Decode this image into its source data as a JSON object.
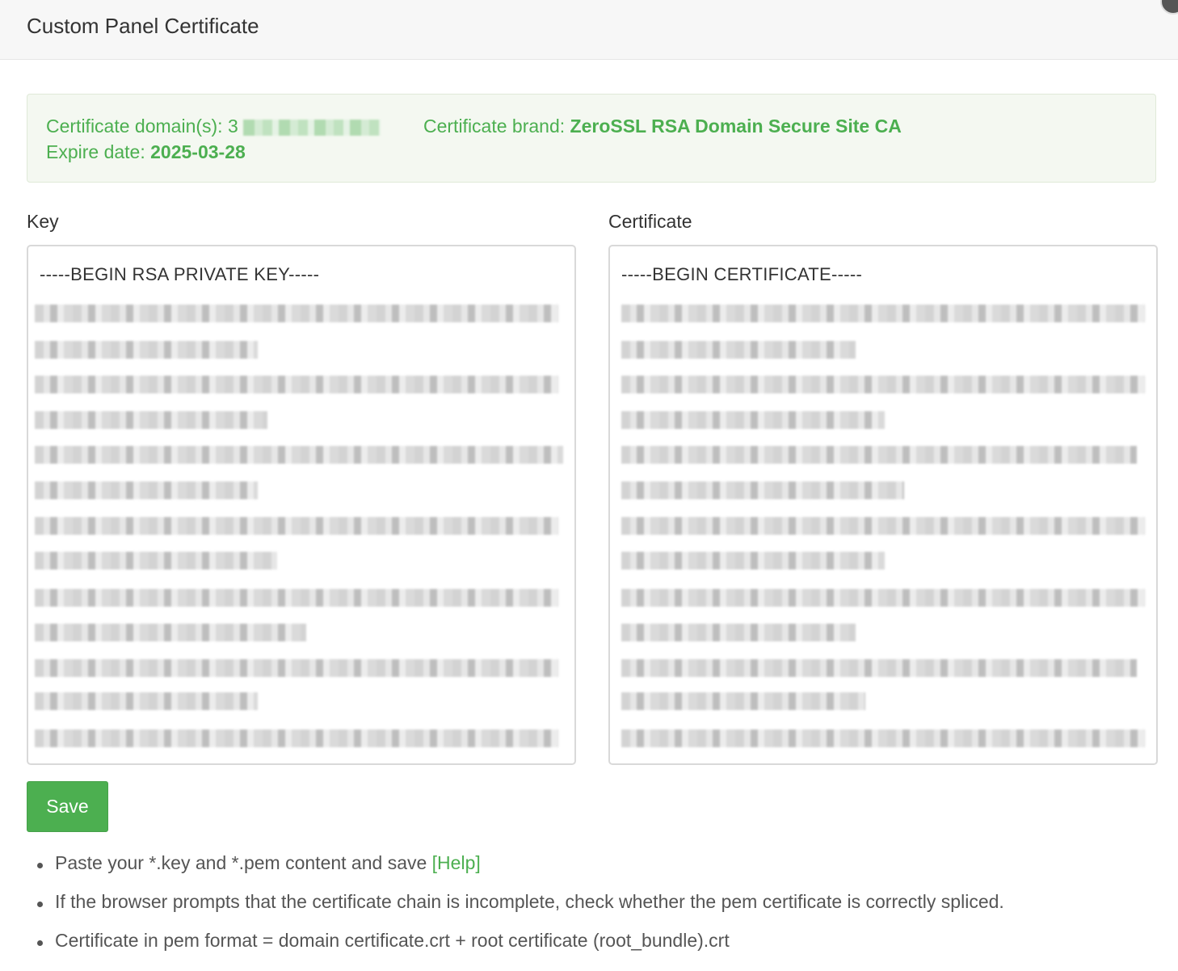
{
  "header": {
    "title": "Custom Panel Certificate"
  },
  "info": {
    "domain_label": "Certificate domain(s): ",
    "domain_visible_prefix": "3",
    "brand_label": "Certificate brand: ",
    "brand_value": "ZeroSSL RSA Domain Secure Site CA",
    "expire_label": "Expire date: ",
    "expire_value": "2025-03-28"
  },
  "key_field": {
    "label": "Key",
    "first_line": "-----BEGIN RSA PRIVATE KEY-----"
  },
  "cert_field": {
    "label": "Certificate",
    "first_line": "-----BEGIN CERTIFICATE-----"
  },
  "save_label": "Save",
  "notes": {
    "note1_text": "Paste your *.key and *.pem content and save ",
    "help_link": "[Help]",
    "note2": "If the browser prompts that the certificate chain is incomplete, check whether the pem certificate is correctly spliced.",
    "note3": "Certificate in pem format = domain certificate.crt + root certificate (root_bundle).crt"
  },
  "colors": {
    "accent": "#4caf50",
    "info_bg": "#f4f8f1",
    "header_bg": "#f7f7f7"
  }
}
